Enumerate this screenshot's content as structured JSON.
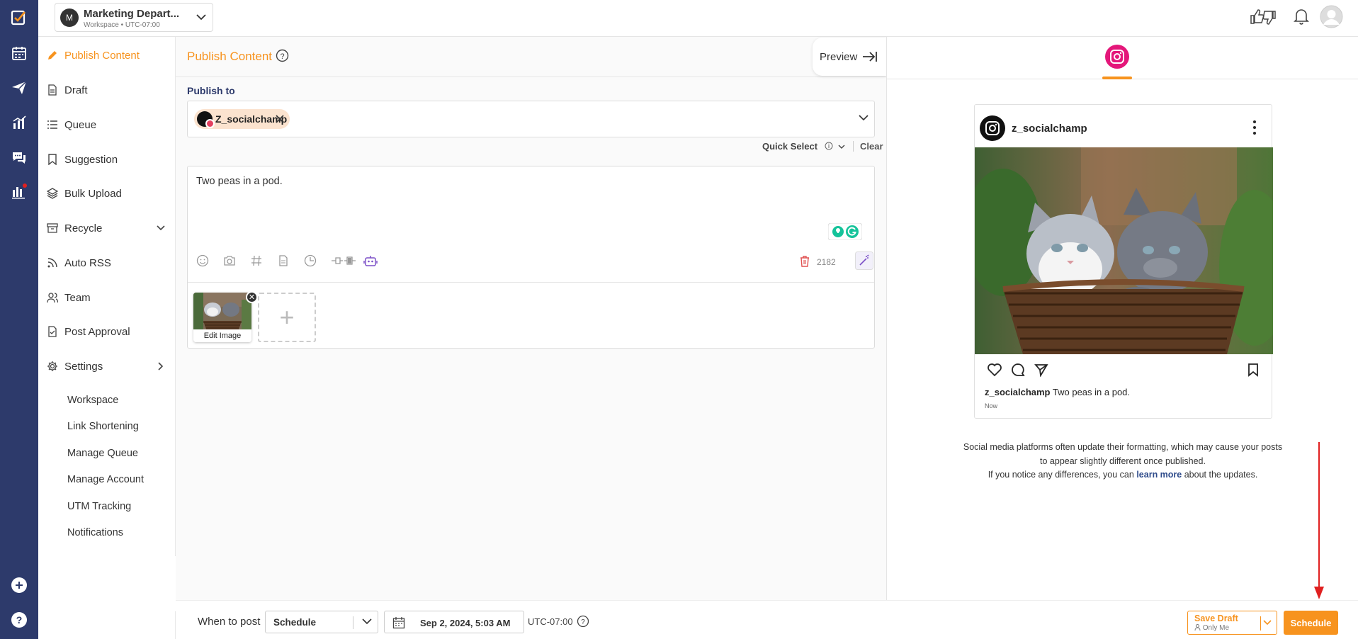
{
  "workspace": {
    "avatar_letter": "M",
    "name": "Marketing Depart...",
    "sub": "Workspace • UTC-07:00"
  },
  "sidebar": {
    "items": [
      {
        "label": "Publish Content",
        "icon": "pencil-icon"
      },
      {
        "label": "Draft",
        "icon": "document-icon"
      },
      {
        "label": "Queue",
        "icon": "list-icon"
      },
      {
        "label": "Suggestion",
        "icon": "bookmark-icon"
      },
      {
        "label": "Bulk Upload",
        "icon": "layers-icon"
      },
      {
        "label": "Recycle",
        "icon": "archive-icon"
      },
      {
        "label": "Auto RSS",
        "icon": "rss-icon"
      },
      {
        "label": "Team",
        "icon": "users-icon"
      },
      {
        "label": "Post Approval",
        "icon": "approval-icon"
      },
      {
        "label": "Settings",
        "icon": "gear-icon"
      }
    ],
    "settings_sub": [
      "Workspace",
      "Link Shortening",
      "Manage Queue",
      "Manage Account",
      "UTM Tracking",
      "Notifications"
    ]
  },
  "editor": {
    "title": "Publish Content",
    "preview_label": "Preview",
    "publish_to_label": "Publish to",
    "account_chip": "Z_socialchamp",
    "quick_select": "Quick Select",
    "clear": "Clear",
    "post_text": "Two peas in a pod.",
    "char_count": "2182",
    "edit_image_label": "Edit Image"
  },
  "preview": {
    "username": "z_socialchamp",
    "caption_user": "z_socialchamp",
    "caption_text": "Two peas in a pod.",
    "time": "Now",
    "note_line1": "Social media platforms often update their formatting, which may cause your posts",
    "note_line2": "to appear slightly different once published.",
    "note_line3_pre": "If you notice any differences, you can",
    "note_link": "learn more",
    "note_line3_post": "about the updates."
  },
  "bottom": {
    "when_label": "When to post",
    "mode": "Schedule",
    "date": "Sep 2, 2024, 5:03 AM",
    "timezone": "UTC-07:00",
    "save_draft": "Save Draft",
    "save_draft_sub": "Only Me",
    "schedule_btn": "Schedule"
  },
  "colors": {
    "accent": "#f7931e",
    "rail": "#2d3a6b",
    "instagram": "#e4177a",
    "annotation": "#e02020"
  }
}
